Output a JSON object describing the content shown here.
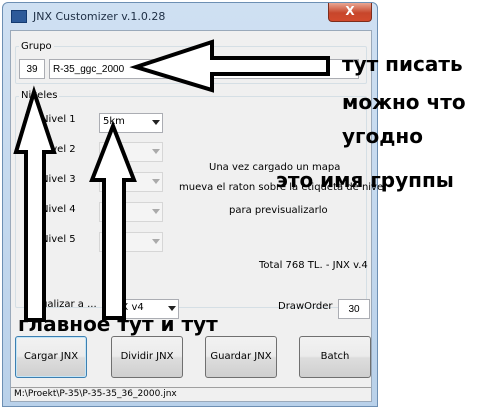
{
  "window": {
    "title": "JNX Customizer v.1.0.28",
    "close_label": "X"
  },
  "grupo": {
    "label": "Grupo",
    "number_value": "39",
    "name_value": "R-35_ggc_2000"
  },
  "niveles": {
    "label": "Niveles",
    "items": [
      {
        "label": "Nivel  1",
        "value": "5km"
      },
      {
        "label": "Nivel  2",
        "value": ""
      },
      {
        "label": "Nivel  3",
        "value": ""
      },
      {
        "label": "Nivel  4",
        "value": ""
      },
      {
        "label": "Nivel  5",
        "value": ""
      }
    ]
  },
  "info": {
    "line1": "Una vez cargado un mapa",
    "line2": "mueva el raton sobre la etiqueta de nivel",
    "line3": "para previsualizarlo",
    "total": "Total 768 TL. - JNX v.4"
  },
  "actualizar": {
    "label": "Actualizar a ...",
    "value": "JNX v4"
  },
  "draworder": {
    "label": "DrawOrder",
    "value": "30"
  },
  "buttons": {
    "cargar": "Cargar JNX",
    "dividir": "Dividir JNX",
    "guardar": "Guardar JNX",
    "batch": "Batch"
  },
  "status": {
    "path": "M:\\Proekt\\P-35\\P-35-35_36_2000.jnx"
  },
  "annotations": {
    "write_here": "тут писать",
    "anything_1": "можно что",
    "anything_2": "угодно",
    "group_name": "это имя группы",
    "main_here": "главное тут и тут"
  }
}
